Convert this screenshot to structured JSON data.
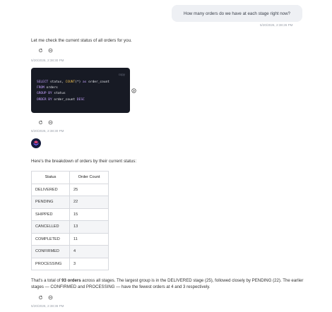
{
  "user_message": {
    "text": "How many orders do we have at each stage right now?",
    "timestamp": "5/20/2026, 2:38:26 PM"
  },
  "assistant_1": {
    "text": "Let me check the current status of all orders for you.",
    "timestamp": "5/20/2026, 2:38:30 PM"
  },
  "code_block": {
    "copy_label": "copy",
    "lines": [
      [
        {
          "t": "SELECT",
          "c": "kw"
        },
        {
          "t": " status, ",
          "c": "tx"
        },
        {
          "t": "COUNT",
          "c": "fn"
        },
        {
          "t": "(*) ",
          "c": "tx"
        },
        {
          "t": "as",
          "c": "kw"
        },
        {
          "t": " order_count",
          "c": "tx"
        }
      ],
      [
        {
          "t": "FROM",
          "c": "kw"
        },
        {
          "t": " orders",
          "c": "tx"
        }
      ],
      [
        {
          "t": "GROUP BY",
          "c": "kw"
        },
        {
          "t": " status",
          "c": "tx"
        }
      ],
      [
        {
          "t": "ORDER BY",
          "c": "kw"
        },
        {
          "t": " order_count ",
          "c": "tx"
        },
        {
          "t": "DESC",
          "c": "kw"
        }
      ]
    ],
    "timestamp": "5/20/2026, 2:38:30 PM"
  },
  "assistant_2": {
    "intro": "Here's the breakdown of orders by their current status:",
    "table": {
      "headers": [
        "Status",
        "Order Count"
      ],
      "rows": [
        [
          "DELIVERED",
          "25"
        ],
        [
          "PENDING",
          "22"
        ],
        [
          "SHIPPED",
          "15"
        ],
        [
          "CANCELLED",
          "13"
        ],
        [
          "COMPLETED",
          "11"
        ],
        [
          "CONFIRMED",
          "4"
        ],
        [
          "PROCESSING",
          "3"
        ]
      ]
    },
    "summary": {
      "before": "That's a total of ",
      "bold": "93 orders",
      "after": " across all stages. The largest group is in the DELIVERED stage (25), followed closely by PENDING (22). The earlier stages — CONFIRMED and PROCESSING — have the fewest orders at 4 and 3 respectively."
    },
    "timestamp": "5/20/2026, 2:38:36 PM"
  },
  "colors": {
    "code_bg": "#171a24",
    "keyword": "#c5a3ff",
    "function": "#e6b94e",
    "avatar_bg": "#141b3c"
  },
  "icons": [
    "retry-icon",
    "info-icon",
    "expand-icon",
    "assistant-avatar-icon"
  ]
}
